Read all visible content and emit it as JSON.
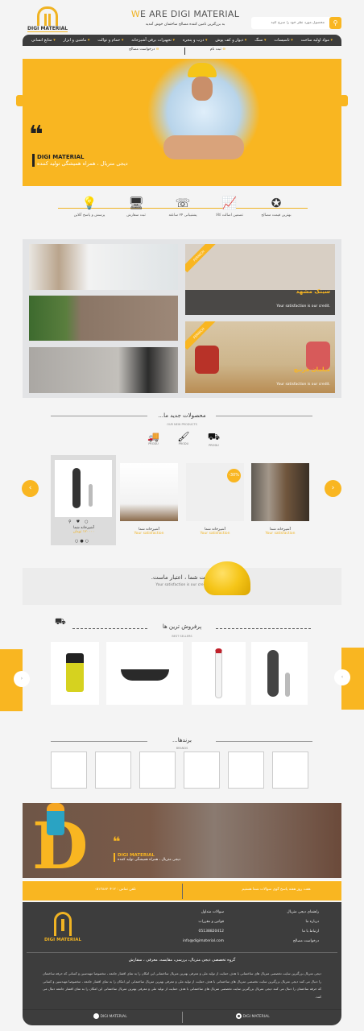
{
  "header": {
    "logo_text": "DIGI MATERIAL",
    "tagline": "WE ARE DIGI MATERIAL",
    "tagline_first": "W",
    "tagline_rest": "E ARE DIGI MATERIAL",
    "subtitle": "به بزرگترین تامین کننده مصالح ساختمان خوش آمدید",
    "search_placeholder": "محصول مورد نظر خود را سرچ کنید"
  },
  "nav": {
    "items": [
      "مواد اولیه ساخت",
      "تاسیسات",
      "سنگ",
      "دیوار و کف پوش",
      "درب و پنجره",
      "تجهیزات برقی آشپزخانه",
      "حمام و توالت",
      "ماشین و ابزار",
      "منابع انسانی"
    ]
  },
  "sublinks": [
    "ثبت نام",
    "درخواست مصالح"
  ],
  "hero": {
    "title": "DIGI MATERIAL",
    "text": "دیجی متریال ، همراه همیشگی تولید کننده"
  },
  "features": [
    "بهترین قیمت مصالح",
    "تضمین اصالت کالا",
    "پشتیبانی ۲۴ ساعته",
    "ثبت سفارش",
    "پرسش و پاسخ آنلاین"
  ],
  "gallery": {
    "ribbon": "FERNICH",
    "items": [
      {
        "title": "سینک مشهد",
        "text": "Your satisfaction is our credit."
      },
      {
        "title": "مبلمان فرنیچ",
        "text": "Your satisfaction is our credit."
      }
    ]
  },
  "new_products": {
    "title": "محصولات جدید ما...",
    "subtitle": "OUR NEW PRODUCTS",
    "icons": [
      {
        "label": "PRODU",
        "icon": "concrete-truck"
      },
      {
        "label": "PRODU",
        "icon": "paint-roller"
      },
      {
        "label": "PRODU",
        "icon": "cement-mixer"
      }
    ],
    "items": [
      {
        "name": "آشپزخانه شما",
        "sub": "Your satisfaction"
      },
      {
        "name": "آشپزخانه شما",
        "sub": "Your satisfaction",
        "badge": "-30%"
      },
      {
        "name": "آشپزخانه شما",
        "sub": "Your satisfaction"
      },
      {
        "name": "آشپزخانه شما",
        "sub": "۱۲۰۰۰۰ تومان"
      }
    ]
  },
  "satisfaction": {
    "title": "رضایت شما ، اعتبار ماست.",
    "subtitle": "Your satisfaction is our credit."
  },
  "best_sellers": {
    "title": "پرفروش ترین ها",
    "subtitle": "BEST SELLERS"
  },
  "brands": {
    "title": "برندها...",
    "subtitle": "BRANDS"
  },
  "footer_banner": {
    "title": "DIGI MATERIAL",
    "text": "دیجی متریال ، همراه همیشگی تولید کننده"
  },
  "contact_bar": {
    "left": "تلفن تماس : ۰۵۱۳۸۸۲۰۴۱۲",
    "right": "هفت روز هفته پاسخ گوی سوالات شما هستیم"
  },
  "footer": {
    "col1": [
      "راهنمای دیجی متریال",
      "درباره ما",
      "ارتباط با ما",
      "درخواست مصالح"
    ],
    "col2": [
      "سوالات متداول",
      "قوانین و مقررات",
      "05138820412",
      "info@digimaterial.com"
    ],
    "logo_text": "DIGI MATERIAL",
    "heading": "گروه تخصصی دیجی متریال، بررسی، مقایسه، معرفی ، سفارش",
    "paragraph": "دیجی متریال بزرگترین سایت تخصصی متریال های ساختمانی با هدف حمایت از تولید ملی و معرفی بهترین متریال ساختمانی این امکان را به تمای اقشار جامعه ، مخصوصا مهندسین و کسانی که حرفه ساختمان را دنبال می کنند دیجی متریال بزرگترین سایت تخصصی متریال های ساختمانی با هدف حمایت از تولید ملی و معرفی بهترین متریال ساختمانی این امکان را به تمای اقشار جامعه ، مخصوصا مهندسین و کسانی که حرفه ساختمان را دنبال می کنند دیجی متریال بزرگترین سایت تخصصی متریال های ساختمانی با هدف حمایت از تولید ملی و معرفی بهترین متریال ساختمانی این امکان را به تمای اقشار جامعه دنبال می کنند.",
    "social": [
      {
        "label": "DIGI MATERIAL",
        "icon": "telegram"
      },
      {
        "label": "DIGI MATERIAL",
        "icon": "instagram"
      }
    ]
  },
  "colors": {
    "accent": "#f9b621",
    "dark": "#3c3c3c"
  }
}
